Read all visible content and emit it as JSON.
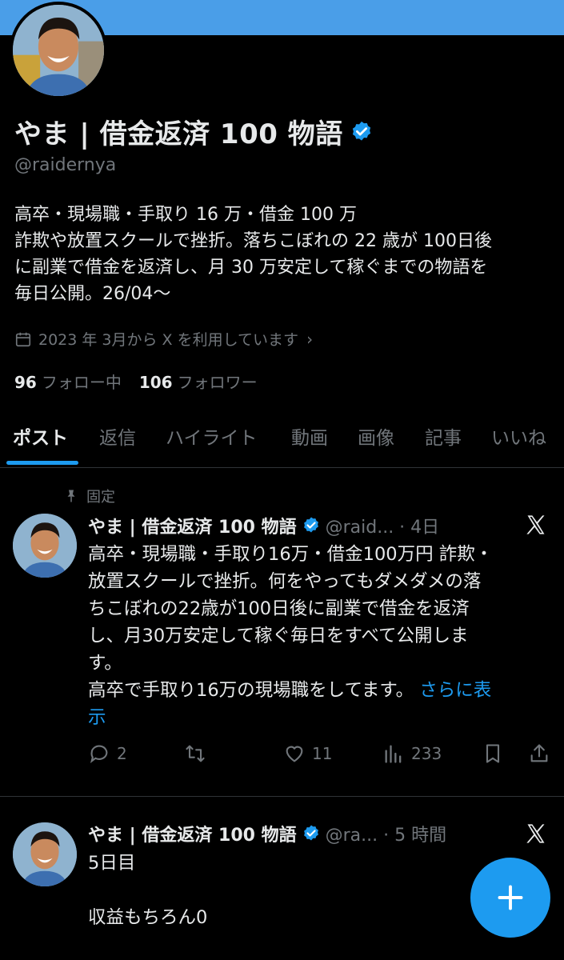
{
  "profile": {
    "display_name": "やま | 借金返済 100 物語",
    "handle": "@raidernya",
    "bio_lines": [
      "高卒・現場職・手取り 16 万・借金 100 万",
      "詐欺や放置スクールで挫折。落ちこぼれの 22 歳が 100日後",
      "に副業で借金を返済し、月 30 万安定して稼ぐまでの物語を",
      "毎日公開。26/04〜"
    ],
    "joined": "2023 年 3月から X を利用しています",
    "following_count": "96",
    "following_label": "フォロー中",
    "followers_count": "106",
    "followers_label": "フォロワー",
    "verified_color": "#1d9bf0"
  },
  "tabs": [
    {
      "label": "ポスト",
      "active": true
    },
    {
      "label": "返信"
    },
    {
      "label": "ハイライト"
    },
    {
      "label": "動画"
    },
    {
      "label": "画像"
    },
    {
      "label": "記事"
    },
    {
      "label": "いいね"
    }
  ],
  "posts": [
    {
      "pinned_label": "固定",
      "name": "やま | 借金返済 100 物語",
      "meta": "@raid... · 4日",
      "body_lines": [
        "高卒・現場職・手取り16万・借金100万円 詐欺・",
        "放置スクールで挫折。何をやってもダメダメの落",
        "ちこぼれの22歳が100日後に副業で借金を返済",
        "し、月30万安定して稼ぐ毎日をすべて公開しま",
        "す。"
      ],
      "body_last_line": "高卒で手取り16万の現場職をしてます。",
      "more_link_1": "さらに表",
      "more_link_2": "示",
      "replies": "2",
      "reposts": "",
      "likes": "11",
      "views": "233"
    },
    {
      "name": "やま | 借金返済 100 物語",
      "meta": "@ra... · 5 時間",
      "body_line_1": "5日目",
      "body_line_2": "収益もちろん0"
    }
  ],
  "icons": {
    "fab": "compose-plus-icon",
    "calendar": "calendar-icon",
    "pin": "pin-icon",
    "x": "x-logo-icon"
  },
  "colors": {
    "accent": "#1d9bf0",
    "banner": "#4a9ee8"
  }
}
